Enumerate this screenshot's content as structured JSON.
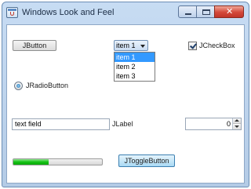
{
  "window": {
    "title": "Windows Look and Feel",
    "close_symbol": "✕"
  },
  "controls": {
    "button_label": "JButton",
    "combo": {
      "selected": "item 1",
      "options": [
        "item 1",
        "item 2",
        "item 3"
      ]
    },
    "checkbox": {
      "label": "JCheckBox",
      "checked": true
    },
    "radio": {
      "label": "JRadioButton",
      "selected": true
    },
    "text_field": {
      "value": "text field"
    },
    "label": "JLabel",
    "spinner": {
      "value": "0"
    },
    "progress": {
      "value": 0.4,
      "color": "#14c214"
    },
    "toggle_label": "JToggleButton"
  },
  "icons": {
    "app": "java-app-icon",
    "minimize": "minimize-icon",
    "maximize": "maximize-icon",
    "close": "close-icon"
  },
  "colors": {
    "titlebar": "#c7dcf3",
    "selection": "#3399ff",
    "close_button": "#d3483a",
    "toggle": "#a9d9f4"
  }
}
